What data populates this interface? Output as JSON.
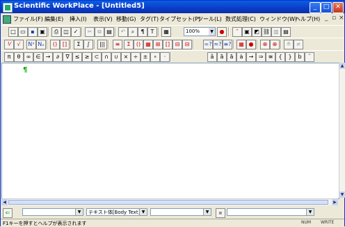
{
  "window": {
    "title": "Scientific WorkPlace - [Untitled5]"
  },
  "menu": [
    "ファイル(F)",
    "編集(E)",
    "挿入(I)",
    "表示(V)",
    "移動(G)",
    "タグ(T)",
    "タイプセット(P)",
    "ツール(L)",
    "数式処理(C)",
    "ウィンドウ(W)",
    "ヘルプ(H)"
  ],
  "toolbar": {
    "zoom": "100%"
  },
  "toolbar_math": [
    "π",
    "θ",
    "∞",
    "∈",
    "→",
    "∂",
    "∇",
    "≤",
    "≥",
    "⊂",
    "∩",
    "∪",
    "×",
    "÷",
    "±",
    "∘",
    "·"
  ],
  "editor": {
    "pilcrow": "¶"
  },
  "tag_bar": {
    "text_tag": "テキスト体[Body Text]"
  },
  "status": {
    "message": "F1キーを押すとヘルプが表示されます",
    "num": "NUM",
    "write": "WRITE"
  }
}
